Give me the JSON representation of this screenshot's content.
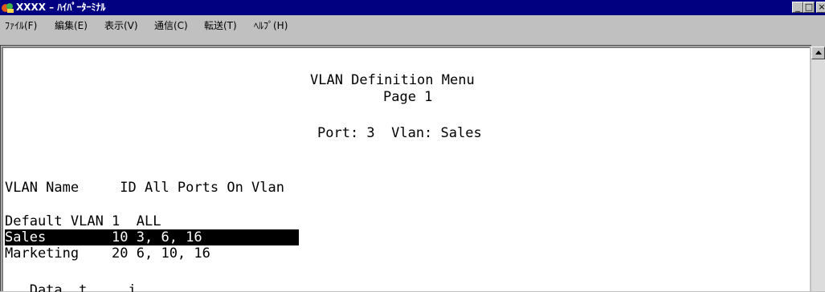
{
  "window": {
    "title": "XXXX – ﾊｲﾊﾟｰﾀｰﾐﾅﾙ",
    "btn_min": "_",
    "btn_max": "□",
    "btn_close": "×"
  },
  "menu": [
    "ﾌｧｲﾙ(F)",
    "編集(E)",
    "表示(V)",
    "通信(C)",
    "転送(T)",
    "ﾍﾙﾌﾟ(H)"
  ],
  "terminal": {
    "heading": "VLAN Definition Menu",
    "page": "Page 1",
    "context": "Port: 3  Vlan: Sales",
    "table_header": "VLAN Name     ID All Ports On Vlan",
    "rows": [
      "Default VLAN 1  ALL",
      "Sales        10 3, 6, 16",
      "Marketing    20 6, 10, 16"
    ],
    "selected_row": 1,
    "cut_line": "   Data  t     i"
  }
}
